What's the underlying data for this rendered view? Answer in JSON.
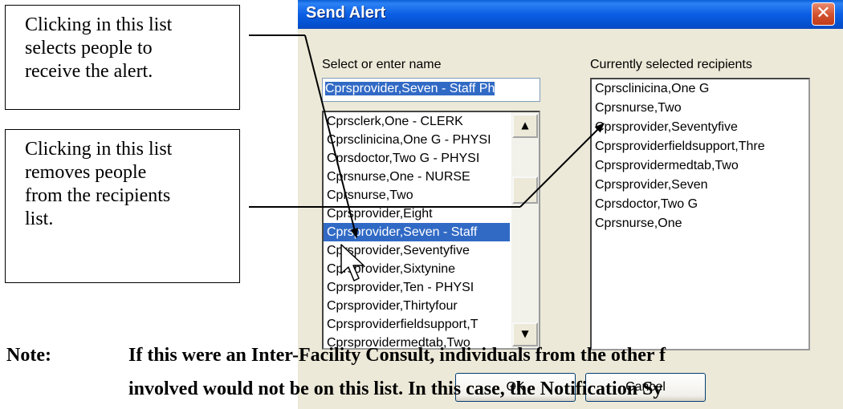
{
  "callouts": {
    "select_people": [
      "Clicking in this list",
      "selects people to",
      "receive the alert."
    ],
    "remove_people": [
      "Clicking in this list",
      "removes people",
      "from the recipients",
      "list."
    ]
  },
  "dialog": {
    "title": "Send Alert",
    "close_icon": "close-icon",
    "select_label": "Select or enter name",
    "selected_label": "Currently selected recipients",
    "name_input_value": "Cprsprovider,Seven - Staff Ph",
    "names": [
      "Cprsclerk,One - CLERK",
      "Cprsclinicina,One G - PHYSI",
      "Cprsdoctor,Two G - PHYSI",
      "Cprsnurse,One - NURSE",
      "Cprsnurse,Two",
      "Cprsprovider,Eight",
      "Cprsprovider,Seven - Staff",
      "Cprsprovider,Seventyfive",
      "Cprsprovider,Sixtynine",
      "Cprsprovider,Ten - PHYSI",
      "Cprsprovider,Thirtyfour",
      "Cprsproviderfieldsupport,T",
      "Cprsprovidermedtab,Two"
    ],
    "selected_name_index": 6,
    "recipients": [
      "Cprsclinicina,One G",
      "Cprsnurse,Two",
      "Cprsprovider,Seventyfive",
      "Cprsproviderfieldsupport,Thre",
      "Cprsprovidermedtab,Two",
      "Cprsprovider,Seven",
      "Cprsdoctor,Two G",
      "Cprsnurse,One"
    ],
    "ok_label": "OK",
    "cancel_label": "Cancel"
  },
  "note": {
    "label": "Note:",
    "line1": "If this were an Inter-Facility Consult, individuals from the other f",
    "line2": "involved would not be on this list. In this case, the Notification Sy"
  },
  "colors": {
    "titlebar": "#0b5ee3",
    "selection": "#316ac5",
    "dialog_bg": "#ece9d8",
    "close_button": "#d2502d"
  }
}
